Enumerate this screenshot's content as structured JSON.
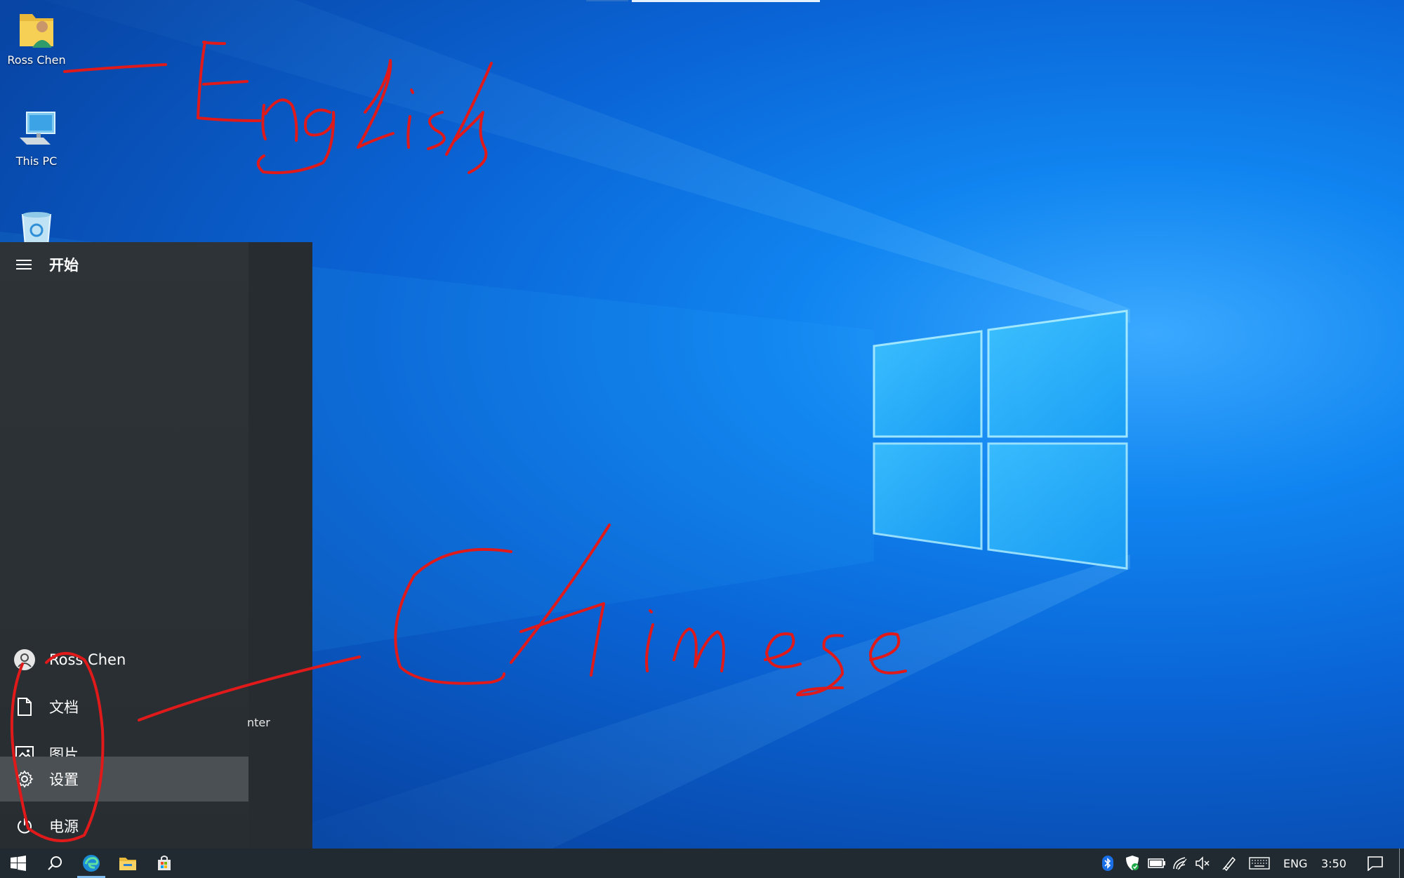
{
  "desktop": {
    "icons": [
      {
        "label": "Ross Chen",
        "icon": "user-folder-icon"
      },
      {
        "label": "This PC",
        "icon": "computer-icon"
      },
      {
        "label": "",
        "icon": "recycle-bin-icon"
      }
    ]
  },
  "start_menu": {
    "title": "开始",
    "user": "Ross Chen",
    "items": [
      {
        "label": "文档",
        "icon": "document-icon"
      },
      {
        "label": "图片",
        "icon": "pictures-icon"
      },
      {
        "label": "设置",
        "icon": "gear-icon"
      },
      {
        "label": "电源",
        "icon": "power-icon"
      }
    ],
    "selected_item": "设置",
    "partial_text": "nter"
  },
  "taskbar": {
    "apps": [
      "windows-start-icon",
      "search-icon",
      "edge-icon",
      "file-explorer-icon",
      "store-icon"
    ],
    "tray": {
      "language": "ENG",
      "time": "3:50"
    }
  },
  "annotations": {
    "handwritten": [
      "English",
      "Chinese"
    ],
    "color": "#e01a1a"
  },
  "colors": {
    "desktop_blue": "#0a63d4",
    "start_menu_bg": "#2a3034",
    "taskbar_bg": "#202a30",
    "selection_bg": "#4a5054"
  }
}
